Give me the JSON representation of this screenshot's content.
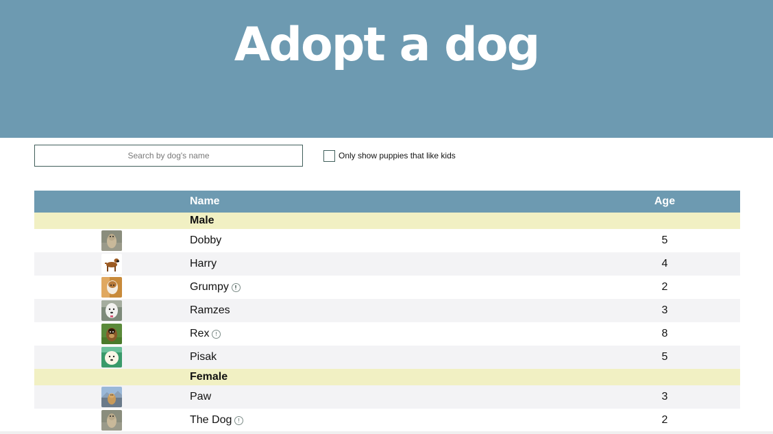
{
  "header": {
    "title": "Adopt a dog"
  },
  "search": {
    "placeholder": "Search by dog's name",
    "value": ""
  },
  "filter": {
    "label": "Only show puppies that like kids",
    "checked": false
  },
  "table": {
    "columns": {
      "photo": "",
      "name": "Name",
      "age": "Age"
    },
    "groups": [
      {
        "label": "Male",
        "dogs": [
          {
            "name": "Dobby",
            "age": "5",
            "info": false,
            "photo": "dog-photo-grey"
          },
          {
            "name": "Harry",
            "age": "4",
            "info": false,
            "photo": "dog-photo-boxer"
          },
          {
            "name": "Grumpy",
            "age": "2",
            "info": true,
            "photo": "dog-photo-tan"
          },
          {
            "name": "Ramzes",
            "age": "3",
            "info": false,
            "photo": "dog-photo-white"
          },
          {
            "name": "Rex",
            "age": "8",
            "info": true,
            "photo": "dog-photo-shepherd"
          },
          {
            "name": "Pisak",
            "age": "5",
            "info": false,
            "photo": "dog-photo-puppy"
          }
        ]
      },
      {
        "label": "Female",
        "dogs": [
          {
            "name": "Paw",
            "age": "3",
            "info": false,
            "photo": "dog-photo-mountain"
          },
          {
            "name": "The Dog",
            "age": "2",
            "info": true,
            "photo": "dog-photo-grey"
          }
        ]
      }
    ]
  },
  "colors": {
    "header_bg": "#6d9ab1",
    "group_bg": "#f1f0c3",
    "stripe_bg": "#f3f3f5",
    "border": "#3f5e5a"
  }
}
